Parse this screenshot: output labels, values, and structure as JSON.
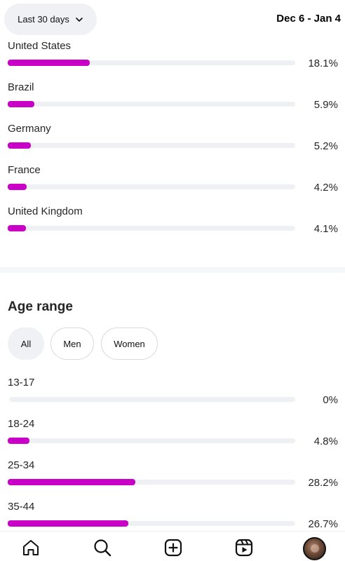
{
  "header": {
    "range_label": "Last 30 days",
    "date_range": "Dec 6 - Jan 4"
  },
  "locations": [
    {
      "label": "United States",
      "percent_text": "18.1%",
      "percent": 18.1
    },
    {
      "label": "Brazil",
      "percent_text": "5.9%",
      "percent": 5.9
    },
    {
      "label": "Germany",
      "percent_text": "5.2%",
      "percent": 5.2
    },
    {
      "label": "France",
      "percent_text": "4.2%",
      "percent": 4.2
    },
    {
      "label": "United Kingdom",
      "percent_text": "4.1%",
      "percent": 4.1
    }
  ],
  "age_section": {
    "title": "Age range",
    "filters": [
      "All",
      "Men",
      "Women"
    ],
    "selected_filter": "All",
    "rows": [
      {
        "label": "13-17",
        "percent_text": "0%",
        "percent": 0
      },
      {
        "label": "18-24",
        "percent_text": "4.8%",
        "percent": 4.8
      },
      {
        "label": "25-34",
        "percent_text": "28.2%",
        "percent": 28.2
      },
      {
        "label": "35-44",
        "percent_text": "26.7%",
        "percent": 26.7
      }
    ]
  },
  "bottom_nav": {
    "items": [
      "home-icon",
      "search-icon",
      "create-icon",
      "reels-icon",
      "profile-avatar"
    ]
  },
  "colors": {
    "bar_fill": "#c800c8",
    "bar_track": "#eff0f3",
    "chip_active": "#f0f1f4"
  }
}
